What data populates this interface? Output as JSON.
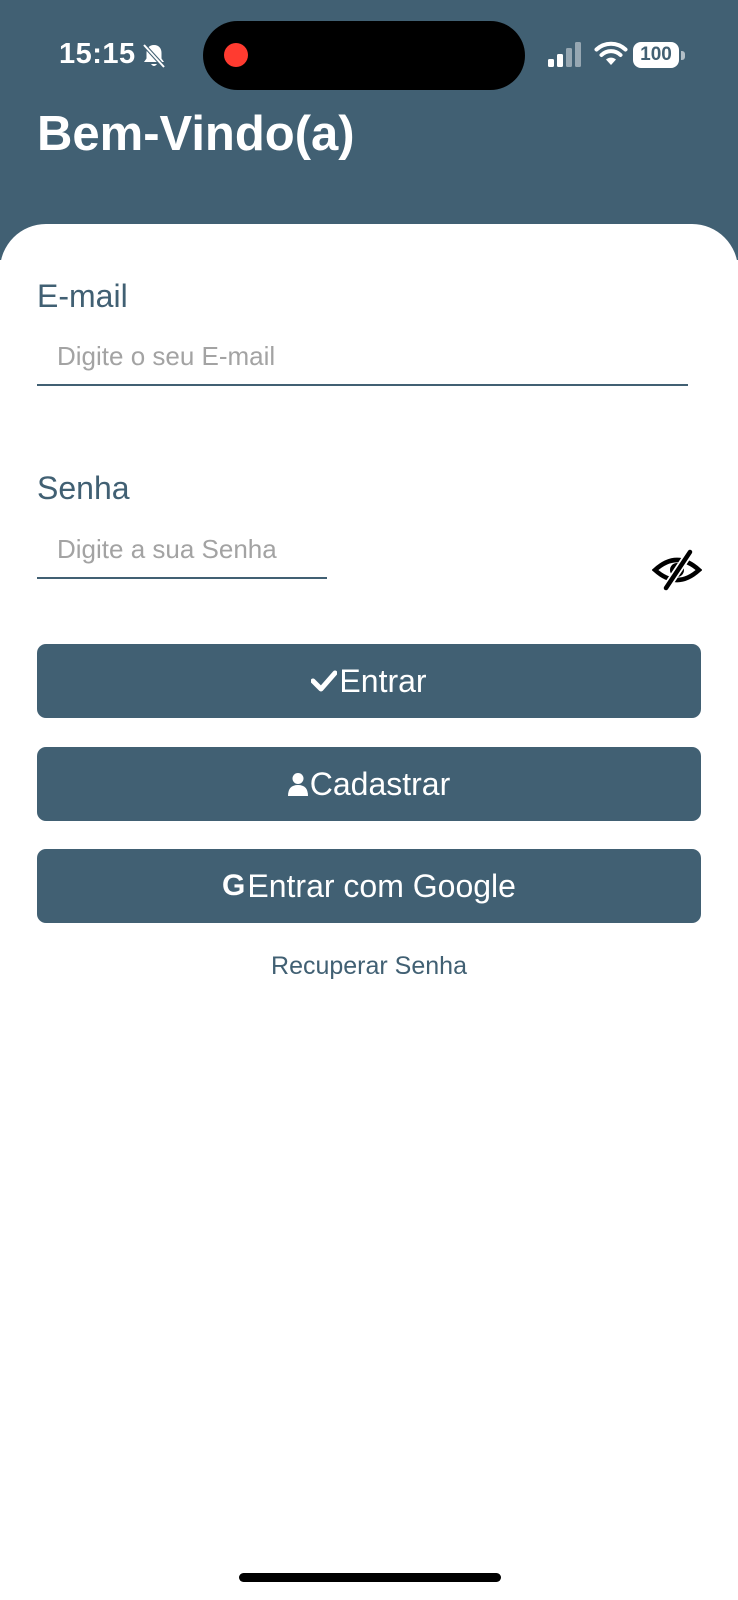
{
  "status_bar": {
    "time": "15:15",
    "battery": "100"
  },
  "header": {
    "title": "Bem-Vindo(a)"
  },
  "form": {
    "email_label": "E-mail",
    "email_placeholder": "Digite o seu E-mail",
    "email_value": "",
    "password_label": "Senha",
    "password_placeholder": "Digite a sua Senha",
    "password_value": ""
  },
  "buttons": {
    "login_label": "Entrar",
    "register_label": "Cadastrar",
    "google_label": "Entrar com Google",
    "google_icon_letter": "G"
  },
  "links": {
    "recover_password": "Recuperar Senha"
  },
  "colors": {
    "primary": "#416073",
    "background": "#ffffff",
    "placeholder": "#a3a3a3",
    "record_indicator": "#ff3b30"
  },
  "icons": {
    "status": [
      "bell-slash-icon",
      "cellular-signal-icon",
      "wifi-icon",
      "battery-icon"
    ],
    "password_toggle": "eye-slash-icon",
    "login": "check-icon",
    "register": "user-icon",
    "google": "google-icon"
  }
}
